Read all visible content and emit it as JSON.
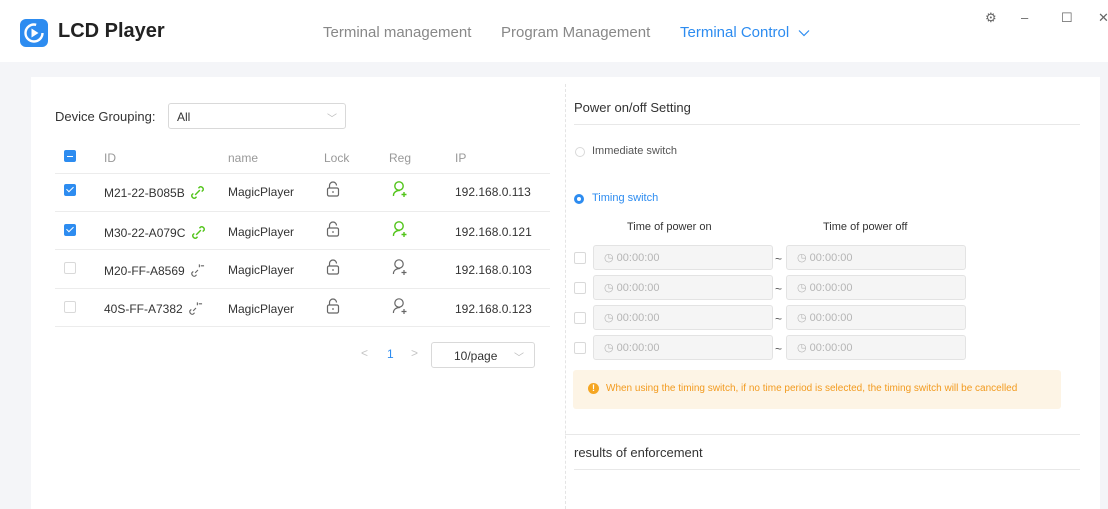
{
  "app": {
    "name": "LCD Player"
  },
  "nav": {
    "items": [
      "Terminal management",
      "Program Management",
      "Terminal Control"
    ],
    "active": "Terminal Control"
  },
  "window_controls": {
    "settings": "⚙",
    "minimize": "–",
    "maximize": "☐",
    "close": "✕"
  },
  "device_panel": {
    "group_label": "Device Grouping:",
    "group_value": "All",
    "columns": [
      "ID",
      "name",
      "Lock",
      "Reg",
      "IP"
    ],
    "rows": [
      {
        "checked": true,
        "id": "M21-22-B085B",
        "linked": true,
        "name": "MagicPlayer",
        "registered": true,
        "ip": "192.168.0.113"
      },
      {
        "checked": true,
        "id": "M30-22-A079C",
        "linked": true,
        "name": "MagicPlayer",
        "registered": true,
        "ip": "192.168.0.121"
      },
      {
        "checked": false,
        "id": "M20-FF-A8569",
        "linked": false,
        "name": "MagicPlayer",
        "registered": false,
        "ip": "192.168.0.103"
      },
      {
        "checked": false,
        "id": "40S-FF-A7382",
        "linked": false,
        "name": "MagicPlayer",
        "registered": false,
        "ip": "192.168.0.123"
      }
    ],
    "pagination": {
      "current_page": "1",
      "page_size": "10/page",
      "prev": "<",
      "next": ">"
    }
  },
  "power_panel": {
    "title": "Power on/off Setting",
    "immediate_label": "Immediate switch",
    "timing_label": "Timing switch",
    "selected_mode": "Timing switch",
    "time_on_header": "Time of power on",
    "time_off_header": "Time of power off",
    "periods": [
      {
        "on": "00:00:00",
        "off": "00:00:00"
      },
      {
        "on": "00:00:00",
        "off": "00:00:00"
      },
      {
        "on": "00:00:00",
        "off": "00:00:00"
      },
      {
        "on": "00:00:00",
        "off": "00:00:00"
      }
    ],
    "separator": "~",
    "notice": "When using the timing switch, if no time period is selected, the timing switch will be cancelled",
    "results_title": "results of enforcement"
  },
  "colors": {
    "accent": "#2d8cf0",
    "green": "#52c41a",
    "warning": "#f29b20",
    "warning_bg": "#fdf4e5"
  }
}
